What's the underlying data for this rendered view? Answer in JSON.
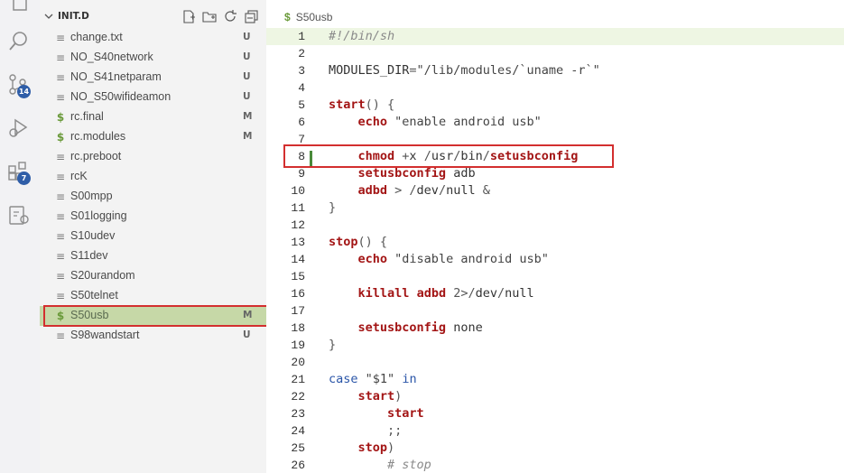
{
  "activity_bar": {
    "items": [
      {
        "icon": "files-icon"
      },
      {
        "icon": "search-icon"
      },
      {
        "icon": "source-control-icon",
        "badge": "14"
      },
      {
        "icon": "run-debug-icon"
      },
      {
        "icon": "extensions-icon",
        "badge": "7"
      },
      {
        "icon": "remote-settings-icon"
      }
    ]
  },
  "sidebar": {
    "title": "INIT.D",
    "files": [
      {
        "name": "change.txt",
        "icon": "≡",
        "status": "U"
      },
      {
        "name": "NO_S40network",
        "icon": "≡",
        "status": "U"
      },
      {
        "name": "NO_S41netparam",
        "icon": "≡",
        "status": "U"
      },
      {
        "name": "NO_S50wifideamon",
        "icon": "≡",
        "status": "U"
      },
      {
        "name": "rc.final",
        "icon": "$",
        "status": "M"
      },
      {
        "name": "rc.modules",
        "icon": "$",
        "status": "M"
      },
      {
        "name": "rc.preboot",
        "icon": "≡",
        "status": ""
      },
      {
        "name": "rcK",
        "icon": "≡",
        "status": ""
      },
      {
        "name": "S00mpp",
        "icon": "≡",
        "status": ""
      },
      {
        "name": "S01logging",
        "icon": "≡",
        "status": ""
      },
      {
        "name": "S10udev",
        "icon": "≡",
        "status": ""
      },
      {
        "name": "S11dev",
        "icon": "≡",
        "status": ""
      },
      {
        "name": "S20urandom",
        "icon": "≡",
        "status": ""
      },
      {
        "name": "S50telnet",
        "icon": "≡",
        "status": ""
      },
      {
        "name": "S50usb",
        "icon": "$",
        "status": "M"
      },
      {
        "name": "S98wandstart",
        "icon": "≡",
        "status": "U"
      }
    ]
  },
  "editor": {
    "breadcrumb_icon": "$",
    "breadcrumb": "S50usb",
    "current_line": 8,
    "lines": [
      {
        "n": "1",
        "text": "#!/bin/sh"
      },
      {
        "n": "2",
        "text": ""
      },
      {
        "n": "3",
        "text": "MODULES_DIR=\"/lib/modules/`uname -r`\""
      },
      {
        "n": "4",
        "text": ""
      },
      {
        "n": "5",
        "text": "start() {"
      },
      {
        "n": "6",
        "text": "    echo \"enable android usb\""
      },
      {
        "n": "7",
        "text": ""
      },
      {
        "n": "8",
        "text": "    chmod +x /usr/bin/setusbconfig"
      },
      {
        "n": "9",
        "text": "    setusbconfig adb"
      },
      {
        "n": "10",
        "text": "    adbd > /dev/null &"
      },
      {
        "n": "11",
        "text": "}"
      },
      {
        "n": "12",
        "text": ""
      },
      {
        "n": "13",
        "text": "stop() {"
      },
      {
        "n": "14",
        "text": "    echo \"disable android usb\""
      },
      {
        "n": "15",
        "text": ""
      },
      {
        "n": "16",
        "text": "    killall adbd 2>/dev/null"
      },
      {
        "n": "17",
        "text": ""
      },
      {
        "n": "18",
        "text": "    setusbconfig none"
      },
      {
        "n": "19",
        "text": "}"
      },
      {
        "n": "20",
        "text": ""
      },
      {
        "n": "21",
        "text": "case \"$1\" in"
      },
      {
        "n": "22",
        "text": "    start)"
      },
      {
        "n": "23",
        "text": "        start"
      },
      {
        "n": "24",
        "text": "        ;;"
      },
      {
        "n": "25",
        "text": "    stop)"
      },
      {
        "n": "26",
        "text": "        # stop"
      }
    ]
  }
}
